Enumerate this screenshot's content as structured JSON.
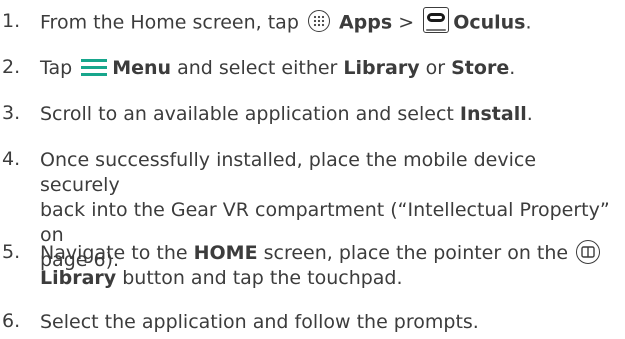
{
  "steps": [
    {
      "num": "1.",
      "line1_pre": "From the Home screen, tap",
      "apps_label": "Apps",
      "sep": ">",
      "oculus_label": "Oculus",
      "period": ".",
      "icons": [
        "apps-icon",
        "oculus-icon"
      ]
    },
    {
      "num": "2.",
      "pre": "Tap",
      "menu_label": "Menu",
      "mid": "and select either",
      "library_label": "Library",
      "or": "or",
      "store_label": "Store",
      "period": ".",
      "icons": [
        "menu-icon"
      ]
    },
    {
      "num": "3.",
      "pre": "Scroll to an available application and select",
      "install_label": "Install",
      "period": "."
    },
    {
      "num": "4.",
      "line1": "Once successfully installed, place the mobile device securely",
      "line2": "back into the Gear VR compartment (“Intellectual Property” on",
      "line3": "page 6)."
    },
    {
      "num": "5.",
      "pre": "Navigate to the",
      "home_label": "HOME",
      "mid": "screen, place the pointer on the",
      "library_label": "Library",
      "post": "button and tap the touchpad.",
      "icons": [
        "library-icon"
      ]
    },
    {
      "num": "6.",
      "text": "Select the application and follow the prompts."
    }
  ],
  "colors": {
    "text": "#3c3c3c",
    "menu_icon": "#17a68c"
  }
}
